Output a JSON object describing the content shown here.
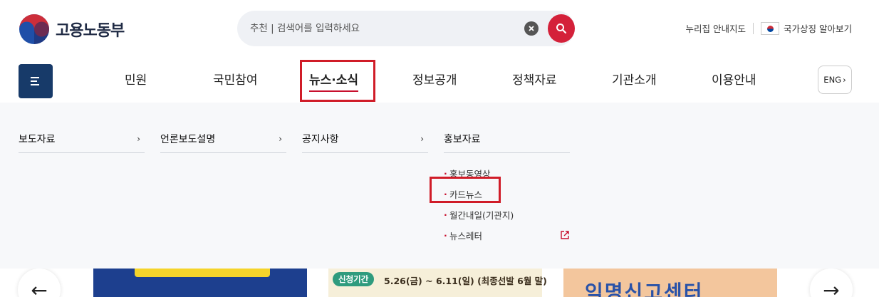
{
  "header": {
    "logo_text": "고용노동부",
    "search": {
      "placeholder": "추천 | 검색어를 입력하세요"
    },
    "util_links": {
      "sitemap": "누리집 안내지도",
      "symbol": "국가상징 알아보기"
    }
  },
  "gnb": {
    "items": [
      "민원",
      "국민참여",
      "뉴스·소식",
      "정보공개",
      "정책자료",
      "기관소개",
      "이용안내"
    ],
    "active_index": 2,
    "eng_label": "ENG",
    "eng_arrow": "›"
  },
  "mega_menu": {
    "columns": [
      {
        "title": "보도자료",
        "arrow": "›"
      },
      {
        "title": "언론보도설명",
        "arrow": "›"
      },
      {
        "title": "공지사항",
        "arrow": "›"
      },
      {
        "title": "홍보자료",
        "sub_items": [
          "홍보동영상",
          "카드뉴스",
          "월간내일(기관지)",
          "뉴스레터"
        ]
      }
    ]
  },
  "banner": {
    "slide2_tag": "신청기간",
    "slide2_date": "5.26(금) ~ 6.11(일) (최종선발 6월 말)",
    "slide3_text": "익명신고센터",
    "prev_arrow": "←",
    "next_arrow": "→"
  },
  "colors": {
    "brand_navy": "#173a69",
    "accent_red": "#d4213a",
    "highlight_box": "#d01c28"
  }
}
